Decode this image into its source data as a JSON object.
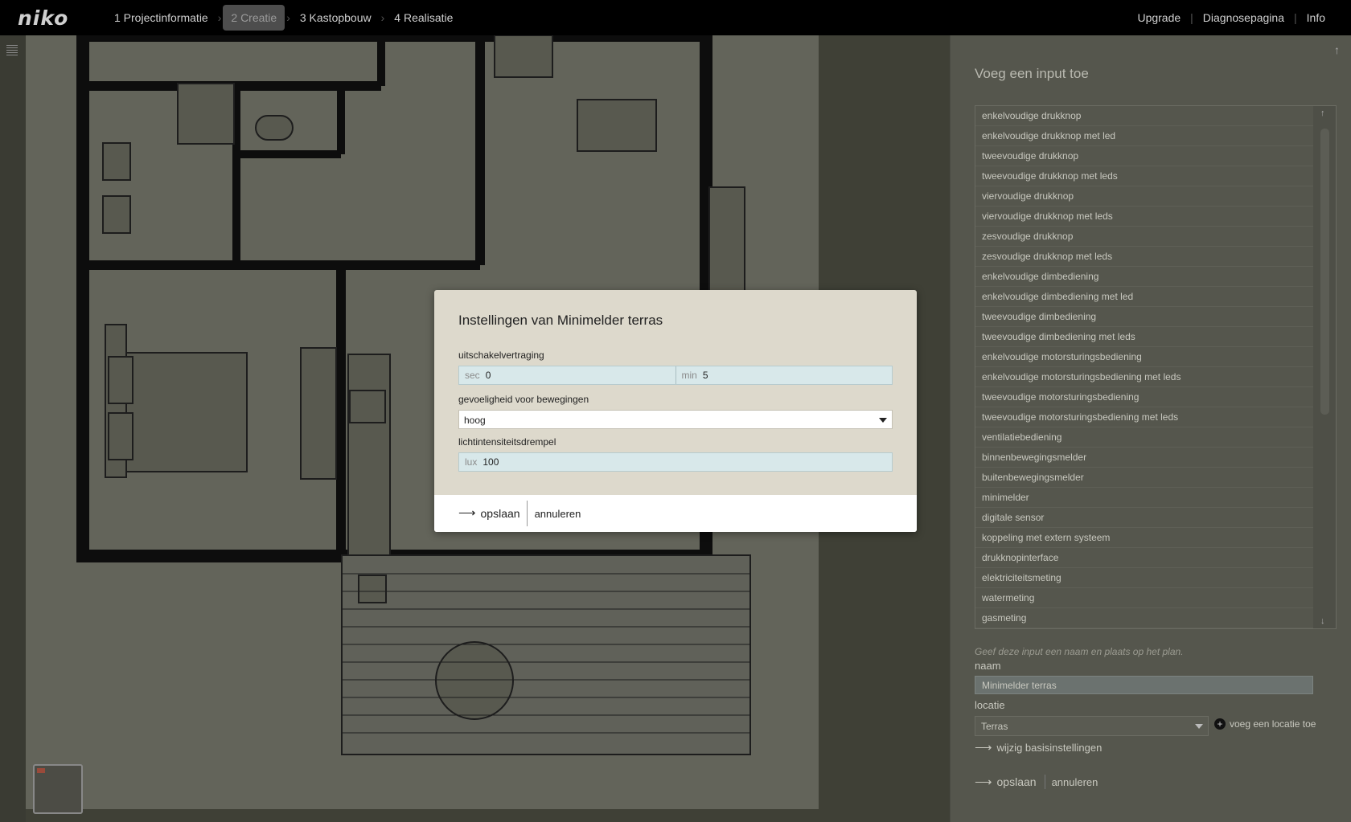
{
  "header": {
    "logo": "niko",
    "steps": [
      {
        "label": "1 Projectinformatie"
      },
      {
        "label": "2 Creatie"
      },
      {
        "label": "3 Kastopbouw"
      },
      {
        "label": "4 Realisatie"
      }
    ],
    "links": [
      "Upgrade",
      "Diagnosepagina",
      "Info"
    ]
  },
  "panel": {
    "title": "Voeg een input toe",
    "items": [
      "enkelvoudige drukknop",
      "enkelvoudige drukknop met led",
      "tweevoudige drukknop",
      "tweevoudige drukknop met leds",
      "viervoudige drukknop",
      "viervoudige drukknop met leds",
      "zesvoudige drukknop",
      "zesvoudige drukknop met leds",
      "enkelvoudige dimbediening",
      "enkelvoudige dimbediening met led",
      "tweevoudige dimbediening",
      "tweevoudige dimbediening met leds",
      "enkelvoudige motorsturingsbediening",
      "enkelvoudige motorsturingsbediening met leds",
      "tweevoudige motorsturingsbediening",
      "tweevoudige motorsturingsbediening met leds",
      "ventilatiebediening",
      "binnenbewegingsmelder",
      "buitenbewegingsmelder",
      "minimelder",
      "digitale sensor",
      "koppeling met extern systeem",
      "drukknopinterface",
      "elektriciteitsmeting",
      "watermeting",
      "gasmeting"
    ],
    "hint": "Geef deze input een naam en plaats op het plan.",
    "naam_label": "naam",
    "naam_value": "Minimelder terras",
    "locatie_label": "locatie",
    "locatie_value": "Terras",
    "add_location": "voeg een locatie toe",
    "basis_link": "wijzig basisinstellingen",
    "save": "opslaan",
    "cancel": "annuleren"
  },
  "modal": {
    "title": "Instellingen van Minimelder terras",
    "delay_label": "uitschakelvertraging",
    "sec_unit": "sec",
    "sec_value": "0",
    "min_unit": "min",
    "min_value": "5",
    "sensitivity_label": "gevoeligheid voor bewegingen",
    "sensitivity_value": "hoog",
    "light_label": "lichtintensiteitsdrempel",
    "lux_unit": "lux",
    "lux_value": "100",
    "save": "opslaan",
    "cancel": "annuleren"
  }
}
